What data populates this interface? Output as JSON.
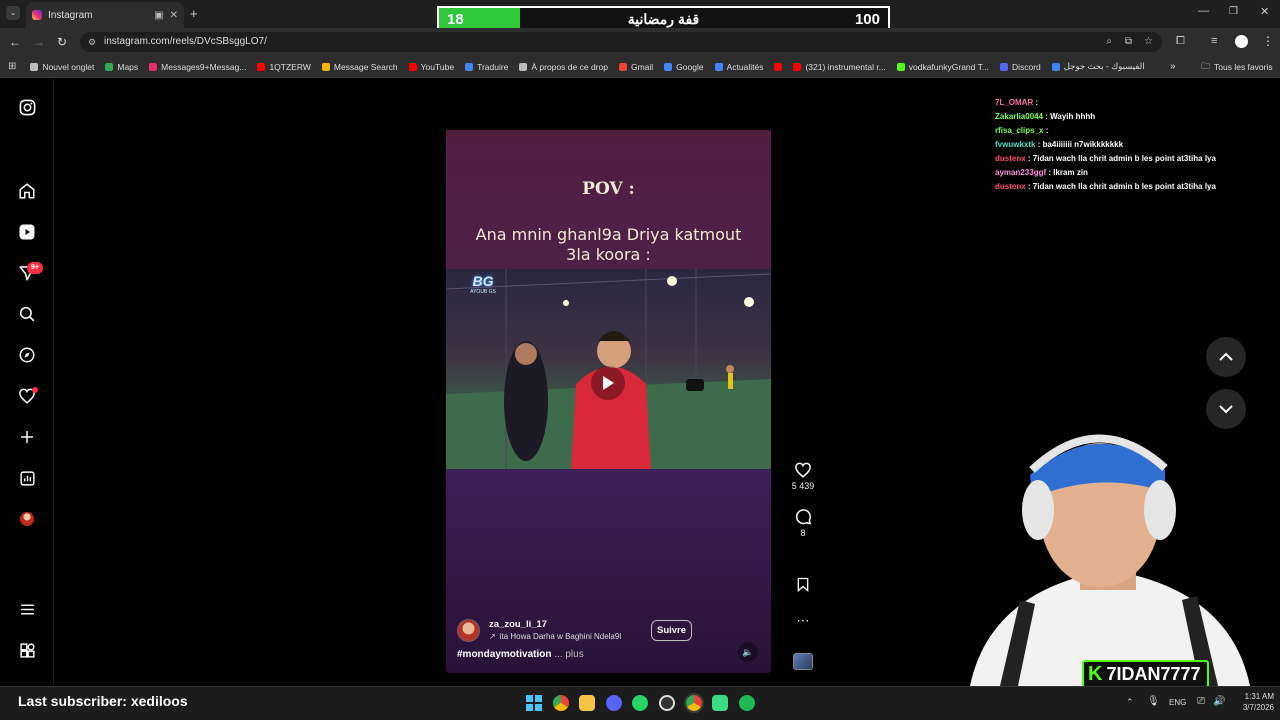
{
  "browser": {
    "tab_title": "Instagram",
    "url": "instagram.com/reels/DVcSBsggLO7/",
    "bookmarks": [
      {
        "label": "Nouvel onglet",
        "color": "#bbbbbb"
      },
      {
        "label": "Maps",
        "color": "#34a853"
      },
      {
        "label": "Messages9+Messag...",
        "color": "#e1306c"
      },
      {
        "label": "1QTZERW",
        "color": "#ff0000"
      },
      {
        "label": "Message Search",
        "color": "#f4b400"
      },
      {
        "label": "YouTube",
        "color": "#ff0000"
      },
      {
        "label": "Traduire",
        "color": "#4285f4"
      },
      {
        "label": "À propos de ce drop",
        "color": "#bbbbbb"
      },
      {
        "label": "Gmail",
        "color": "#ea4335"
      },
      {
        "label": "Google",
        "color": "#4285f4"
      },
      {
        "label": "Actualités",
        "color": "#4285f4"
      },
      {
        "label": "",
        "color": "#ff0000"
      },
      {
        "label": "(321) instrumental r...",
        "color": "#ff0000"
      },
      {
        "label": "vodkafunkyGrand T...",
        "color": "#53fc18"
      },
      {
        "label": "Discord",
        "color": "#5865f2"
      },
      {
        "label": "الفيسبوك - بحث جوجل",
        "color": "#4285f4"
      }
    ],
    "all_bookmarks": "Tous les favoris"
  },
  "score_overlay": {
    "title": "قفة رمضانية",
    "current": "18",
    "goal": "100",
    "progress": 0.18,
    "fill_color": "#2fc83a"
  },
  "sidebar": {
    "notification_badge": "9+",
    "icons": [
      "instagram-logo-icon",
      "home-icon",
      "reels-icon",
      "messages-icon",
      "search-icon",
      "explore-icon",
      "notifications-icon",
      "create-icon",
      "dashboard-icon",
      "profile-icon",
      "menu-icon",
      "more-apps-icon"
    ]
  },
  "reel": {
    "pov": "POV :",
    "caption_line1": "Ana mnin ghanl9a Driya katmout",
    "caption_line2": "3la koora :",
    "watermark": "BG",
    "watermark_sub": "AYOUB GS",
    "username": "za_zou_li_17",
    "audio": "ita Howa Darha w Baghini Ndela9l",
    "follow_label": "Suivre",
    "hashtag": "#mondaymotivation",
    "more": "... plus",
    "likes": "5 439",
    "comments": "8"
  },
  "chat": [
    {
      "user": "7L_OMAR",
      "msg": " : ",
      "color": "#ff6fa8"
    },
    {
      "user": "Zakarlia0044",
      "msg": " : Wayih hhhh",
      "color": "#7dff5a"
    },
    {
      "user": "rfisa_clips_x",
      "msg": " : ",
      "color": "#7dff5a"
    },
    {
      "user": "fvwuwkxtk",
      "msg": " : ba4iiiiiii n7wikkkkkkk",
      "color": "#4de0c8"
    },
    {
      "user": "dustenx",
      "msg": " : 7idan wach lla chrit admin b les point at3tiha lya",
      "color": "#ff4d6d"
    },
    {
      "user": "ayman233ggf",
      "msg": " : Ikram zin",
      "color": "#ff8de0"
    },
    {
      "user": "dustenx",
      "msg": " : 7idan wach lla chrit admin b les point at3tiha lya",
      "color": "#ff4d6d"
    }
  ],
  "streamer": {
    "name": "7IDAN7777",
    "brand_color": "#53fc18"
  },
  "stream_footer": {
    "last_subscriber": "Last subscriber: xediloos"
  },
  "taskbar": {
    "lang": "ENG",
    "time": "1:31 AM",
    "date": "3/7/2026"
  }
}
